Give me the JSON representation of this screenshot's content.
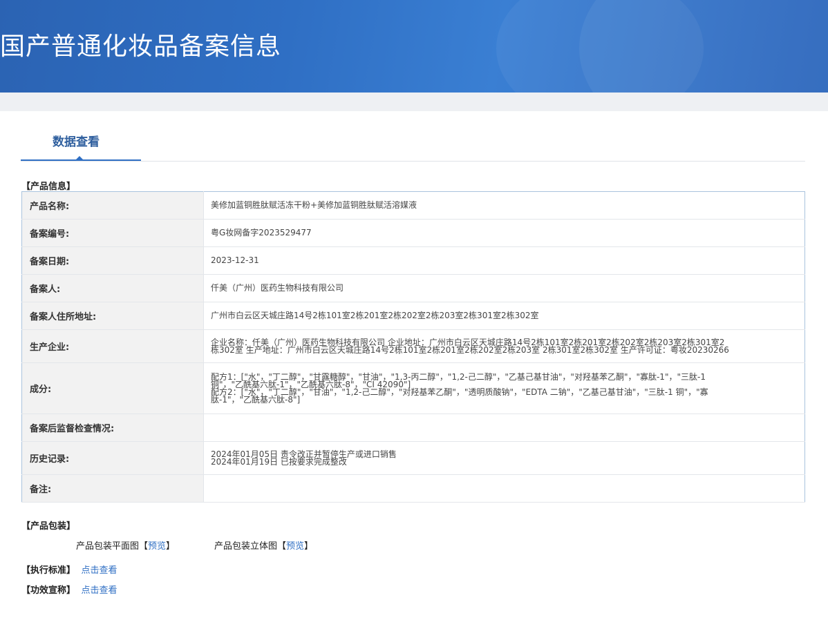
{
  "header": {
    "title": "国产普通化妆品备案信息"
  },
  "tabs": [
    {
      "label": "数据查看",
      "active": true
    }
  ],
  "product_info": {
    "section_title": "【产品信息】",
    "rows": [
      {
        "key": "产品名称:",
        "value": [
          "美修加蓝铜胜肽赋活冻干粉+美修加蓝铜胜肽赋活溶媒液"
        ]
      },
      {
        "key": "备案编号:",
        "value": [
          "粤G妆网备字2023529477"
        ]
      },
      {
        "key": "备案日期:",
        "value": [
          "2023-12-31"
        ]
      },
      {
        "key": "备案人:",
        "value": [
          "仟美（广州）医药生物科技有限公司"
        ]
      },
      {
        "key": "备案人住所地址:",
        "value": [
          "广州市白云区天城庄路14号2栋101室2栋201室2栋202室2栋203室2栋301室2栋302室"
        ]
      },
      {
        "key": "生产企业:",
        "value": [
          "企业名称：仟美（广州）医药生物科技有限公司 企业地址：广州市白云区天城庄路14号2栋101室2栋201室2栋202室2栋203室2栋301室2",
          "栋302室 生产地址：广州市白云区天城庄路14号2栋101室2栋201室2栋202室2栋203室 2栋301室2栋302室 生产许可证：粤妆20230266"
        ]
      },
      {
        "key": "成分:",
        "value": [
          "配方1：[\"水\"，\"丁二醇\"，\"甘露糖醇\"，\"甘油\"，\"1,3-丙二醇\"，\"1,2-己二醇\"，\"乙基己基甘油\"，\"对羟基苯乙酮\"，\"寡肽-1\"，\"三肽-1",
          "铜\"，\"乙酰基六肽-1\"，\"乙酰基六肽-8\"，\"CI 42090\"]",
          "配方2：[\"水\"，\"丁二醇\"，\"甘油\"，\"1,2-己二醇\"，\"对羟基苯乙酮\"，\"透明质酸钠\"，\"EDTA 二钠\"，\"乙基己基甘油\"，\"三肽-1 铜\"，\"寡",
          "肽-1\"，\"乙酰基六肽-8\"]"
        ]
      },
      {
        "key": "备案后监督检查情况:",
        "value": []
      },
      {
        "key": "历史记录:",
        "value": [
          "2024年01月05日 责令改正并暂停生产或进口销售",
          "2024年01月19日 已按要求完成整改"
        ]
      },
      {
        "key": "备注:",
        "value": []
      }
    ]
  },
  "packaging": {
    "section_title": "【产品包装】",
    "items": [
      {
        "label": "产品包装平面图",
        "link": "预览"
      },
      {
        "label": "产品包装立体图",
        "link": "预览"
      }
    ]
  },
  "standard": {
    "section_title": "【执行标准】",
    "link": "点击查看"
  },
  "efficacy": {
    "section_title": "【功效宣称】",
    "link": "点击查看"
  }
}
